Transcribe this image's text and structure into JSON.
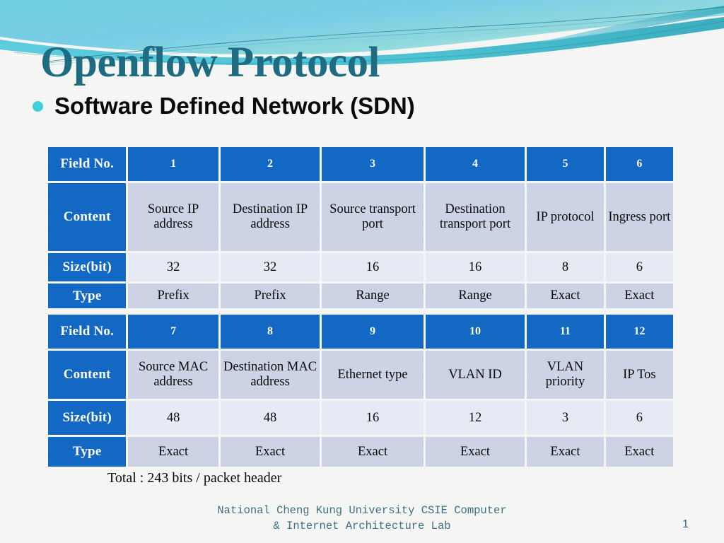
{
  "slide": {
    "title": "Openflow Protocol",
    "bullet_icon": "bullet-dot-icon",
    "subtitle": "Software Defined Network (SDN)",
    "total_note": "Total : 243 bits / packet header",
    "footer_line1": "National Cheng Kung University CSIE Computer",
    "footer_line2": "& Internet Architecture Lab",
    "page_number": "1"
  },
  "colors": {
    "title": "#1e6b82",
    "bullet": "#3fd0d8",
    "header_blue": "#1268c3",
    "row_dark": "#ccd3e4",
    "row_light": "#e6eaf4",
    "footer_text": "#3f6f80",
    "background": "#f7f7f5",
    "banner_cyan": "#5ec9dd",
    "banner_teal": "#2aa9b8"
  },
  "tables": [
    {
      "row_labels": [
        "Field No.",
        "Content",
        "Size(bit)",
        "Type"
      ],
      "field_no": [
        "1",
        "2",
        "3",
        "4",
        "5",
        "6"
      ],
      "content": [
        "Source IP address",
        "Destination IP address",
        "Source transport port",
        "Destination transport port",
        "IP protocol",
        "Ingress port"
      ],
      "size_bit": [
        "32",
        "32",
        "16",
        "16",
        "8",
        "6"
      ],
      "type": [
        "Prefix",
        "Prefix",
        "Range",
        "Range",
        "Exact",
        "Exact"
      ]
    },
    {
      "row_labels": [
        "Field No.",
        "Content",
        "Size(bit)",
        "Type"
      ],
      "field_no": [
        "7",
        "8",
        "9",
        "10",
        "11",
        "12"
      ],
      "content": [
        "Source MAC address",
        "Destination MAC address",
        "Ethernet type",
        "VLAN ID",
        "VLAN priority",
        "IP Tos"
      ],
      "size_bit": [
        "48",
        "48",
        "16",
        "12",
        "3",
        "6"
      ],
      "type": [
        "Exact",
        "Exact",
        "Exact",
        "Exact",
        "Exact",
        "Exact"
      ]
    }
  ]
}
